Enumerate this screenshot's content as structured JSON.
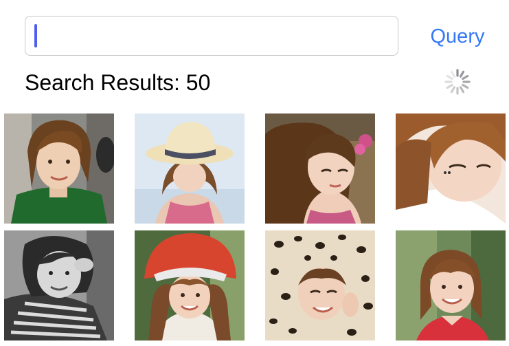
{
  "search": {
    "value": "",
    "placeholder": ""
  },
  "toolbar": {
    "query_label": "Query"
  },
  "results": {
    "label": "Search Results: 50",
    "loading": true,
    "images": [
      {
        "description": "portrait-green-shirt"
      },
      {
        "description": "portrait-straw-hat"
      },
      {
        "description": "portrait-flowers"
      },
      {
        "description": "portrait-white-shirt"
      },
      {
        "description": "portrait-grayscale-striped"
      },
      {
        "description": "portrait-red-helmet"
      },
      {
        "description": "portrait-leopard-hood"
      },
      {
        "description": "portrait-outdoor-smile"
      }
    ]
  },
  "colors": {
    "accent": "#3478f6",
    "caret": "#4f5ef0",
    "border": "#c8c8cc"
  }
}
